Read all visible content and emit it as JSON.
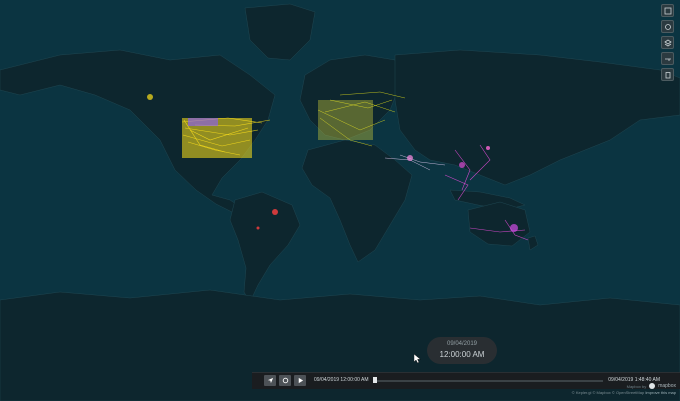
{
  "timeline": {
    "bubble_date": "09/04/2019",
    "bubble_time": "12:00:00 AM",
    "start_label": "09/04/2019 12:00:00 AM",
    "end_label": "09/04/2019 1:48:40 AM",
    "progress": 0.0
  },
  "controls": {
    "locate_icon": "navigation-arrow-icon",
    "loop_icon": "loop-icon",
    "play_icon": "play-icon"
  },
  "toolbar_icons": [
    "info-icon",
    "settings-icon",
    "layers-icon",
    "key-icon",
    "trash-icon"
  ],
  "attribution": {
    "brand_label": "Mapbox by",
    "brand_name": "mapbox",
    "text": "© Kepler.gl © Mapbox © OpenStreetMap ",
    "improve": "Improve this map"
  },
  "colors": {
    "ocean": "#0b2f3a",
    "land": "#0d262e",
    "borders": "#1f4651",
    "accent_yellow": "#ffe21a",
    "accent_magenta": "#e04bd6",
    "accent_red": "#ff4040"
  }
}
